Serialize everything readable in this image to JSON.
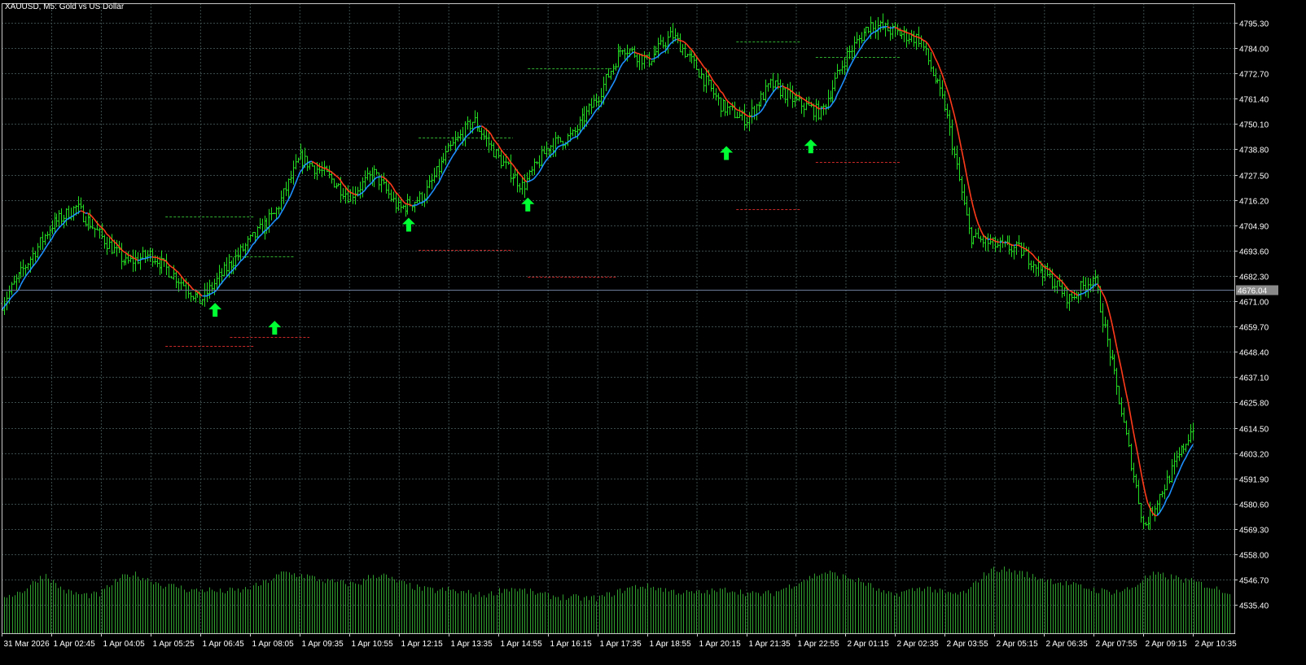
{
  "header": {
    "symbol": "XAUUSD, M5:",
    "description": "Gold vs US Dollar"
  },
  "colors": {
    "background": "#000000",
    "grid": "#3a4a4a",
    "axis": "#c8c8c8",
    "text": "#ffffff",
    "bull_bar": "#22dd22",
    "ma_up": "#1e90ff",
    "ma_down": "#ff3b1b",
    "arrow": "#00ff33",
    "volume": "#2f9e2f",
    "level_green": "#2fae2f",
    "level_red": "#c82828",
    "bid_line": "#6b7d9a",
    "price_box": "#8a8a8a"
  },
  "chart_data": {
    "type": "line",
    "title": "XAUUSD, M5: Gold vs US Dollar",
    "ylim": [
      4528,
      4800
    ],
    "y_ticks": [
      "4795.30",
      "4784.00",
      "4772.70",
      "4761.40",
      "4750.10",
      "4738.80",
      "4727.50",
      "4716.20",
      "4704.90",
      "4693.60",
      "4682.30",
      "4671.00",
      "4659.70",
      "4648.40",
      "4637.10",
      "4625.80",
      "4614.50",
      "4603.20",
      "4591.90",
      "4580.60",
      "4569.30",
      "4558.00",
      "4546.70",
      "4535.40"
    ],
    "x_ticks": [
      "31 Mar 2026",
      "1 Apr 02:45",
      "1 Apr 04:05",
      "1 Apr 05:25",
      "1 Apr 06:45",
      "1 Apr 08:05",
      "1 Apr 09:35",
      "1 Apr 10:55",
      "1 Apr 12:15",
      "1 Apr 13:35",
      "1 Apr 14:55",
      "1 Apr 16:15",
      "1 Apr 17:35",
      "1 Apr 18:55",
      "1 Apr 20:15",
      "1 Apr 21:35",
      "1 Apr 22:55",
      "2 Apr 01:15",
      "2 Apr 02:35",
      "2 Apr 03:55",
      "2 Apr 05:15",
      "2 Apr 06:35",
      "2 Apr 07:55",
      "2 Apr 09:15",
      "2 Apr 10:35"
    ],
    "current_price": "4676.04",
    "series": [
      {
        "kind": "price",
        "x": [
          0,
          1,
          1.5,
          2,
          2.5,
          3,
          3.5,
          4,
          4.5,
          5,
          5.5,
          6,
          6.5,
          7,
          7.5,
          8,
          8.5,
          9,
          9.5,
          10,
          10.5,
          11,
          11.5,
          12,
          12.5,
          13,
          13.5,
          14,
          14.5,
          15,
          15.5,
          16,
          16.5,
          17,
          17.5,
          18,
          18.5,
          19,
          19.5,
          20,
          20.5,
          21,
          21.5,
          22,
          22.5,
          23,
          23.5,
          24
        ],
        "values": [
          4670,
          4705,
          4713,
          4700,
          4688,
          4692,
          4682,
          4671,
          4685,
          4698,
          4710,
          4735,
          4728,
          4718,
          4728,
          4712,
          4718,
          4738,
          4752,
          4735,
          4722,
          4740,
          4745,
          4762,
          4785,
          4778,
          4790,
          4775,
          4758,
          4752,
          4768,
          4760,
          4755,
          4780,
          4795,
          4791,
          4788,
          4758,
          4700,
          4696,
          4694,
          4684,
          4672,
          4682,
          4628,
          4570,
          4592,
          4615
        ]
      },
      {
        "kind": "volume",
        "values": [
          32,
          34,
          37,
          45,
          51,
          42,
          36,
          34,
          33,
          34,
          42,
          48,
          52,
          48,
          45,
          41,
          41,
          38,
          37,
          38,
          36,
          37,
          37,
          40,
          43,
          48,
          53,
          51,
          50,
          47,
          45,
          44,
          43,
          44,
          50,
          51,
          46,
          43,
          40,
          38,
          37,
          38,
          36,
          35,
          33,
          34,
          38,
          39,
          37,
          35,
          33,
          32,
          31,
          31,
          30,
          31,
          34,
          37,
          40,
          41,
          40,
          38,
          36,
          35,
          35,
          36,
          37,
          38,
          36,
          34,
          34,
          35,
          39,
          43,
          47,
          51,
          53,
          50,
          48,
          45,
          41,
          35,
          33,
          36,
          38,
          40,
          37,
          34,
          34,
          37,
          48,
          55,
          56,
          54,
          52,
          49,
          47,
          45,
          43,
          41,
          39,
          37,
          36,
          37,
          39,
          47,
          51,
          50,
          48,
          46,
          44,
          41,
          38,
          36
        ]
      }
    ],
    "signal_arrows": [
      {
        "x": 4.3,
        "y": 4667
      },
      {
        "x": 5.5,
        "y": 4659
      },
      {
        "x": 8.2,
        "y": 4705
      },
      {
        "x": 10.6,
        "y": 4714
      },
      {
        "x": 14.6,
        "y": 4737
      },
      {
        "x": 16.3,
        "y": 4740
      }
    ],
    "levels": [
      {
        "x0": 3.3,
        "x1": 5.1,
        "y": 4709,
        "color": "green"
      },
      {
        "x0": 3.3,
        "x1": 5.1,
        "y": 4651,
        "color": "red"
      },
      {
        "x0": 4.6,
        "x1": 5.9,
        "y": 4691,
        "color": "green"
      },
      {
        "x0": 4.6,
        "x1": 6.2,
        "y": 4655,
        "color": "red"
      },
      {
        "x0": 8.4,
        "x1": 10.3,
        "y": 4744,
        "color": "green"
      },
      {
        "x0": 8.4,
        "x1": 10.3,
        "y": 4694,
        "color": "red"
      },
      {
        "x0": 10.6,
        "x1": 12.4,
        "y": 4775,
        "color": "green"
      },
      {
        "x0": 10.6,
        "x1": 12.4,
        "y": 4682,
        "color": "red"
      },
      {
        "x0": 14.8,
        "x1": 16.1,
        "y": 4787,
        "color": "green"
      },
      {
        "x0": 14.8,
        "x1": 16.1,
        "y": 4712,
        "color": "red"
      },
      {
        "x0": 16.4,
        "x1": 18.1,
        "y": 4780,
        "color": "green"
      },
      {
        "x0": 16.4,
        "x1": 18.1,
        "y": 4733,
        "color": "red"
      }
    ],
    "grid": true
  }
}
